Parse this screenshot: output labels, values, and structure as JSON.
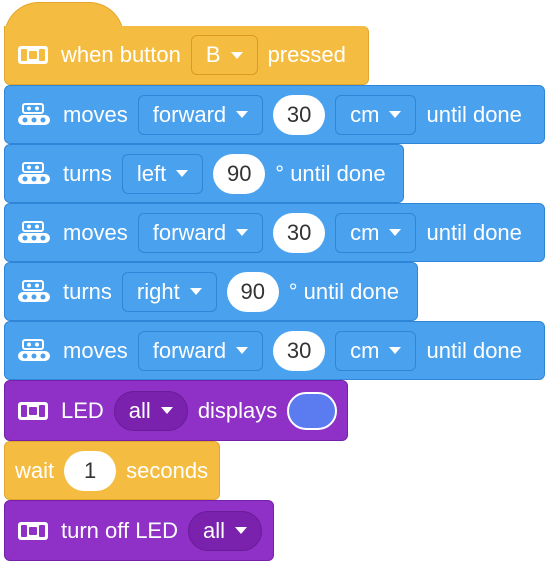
{
  "blocks": {
    "when_button": {
      "label_when": "when button",
      "button_value": "B",
      "label_pressed": "pressed",
      "icon": "controller-icon"
    },
    "move1": {
      "label": "moves",
      "direction": "forward",
      "distance": "30",
      "unit": "cm",
      "suffix": "until done",
      "icon": "robot-icon"
    },
    "turn1": {
      "label": "turns",
      "direction": "left",
      "angle": "90",
      "suffix": "° until done",
      "icon": "robot-icon"
    },
    "move2": {
      "label": "moves",
      "direction": "forward",
      "distance": "30",
      "unit": "cm",
      "suffix": "until done",
      "icon": "robot-icon"
    },
    "turn2": {
      "label": "turns",
      "direction": "right",
      "angle": "90",
      "suffix": "° until done",
      "icon": "robot-icon"
    },
    "move3": {
      "label": "moves",
      "direction": "forward",
      "distance": "30",
      "unit": "cm",
      "suffix": "until done",
      "icon": "robot-icon"
    },
    "led_display": {
      "label": "LED",
      "target": "all",
      "suffix": "displays",
      "color": "#5b7cf0",
      "icon": "controller-icon"
    },
    "wait": {
      "label": "wait",
      "seconds": "1",
      "suffix": "seconds"
    },
    "led_off": {
      "label": "turn off LED",
      "target": "all",
      "icon": "controller-icon"
    }
  },
  "colors": {
    "event": "#f4bd41",
    "motion": "#4aa1ee",
    "looks": "#8f30c6",
    "control": "#f4bd41"
  }
}
